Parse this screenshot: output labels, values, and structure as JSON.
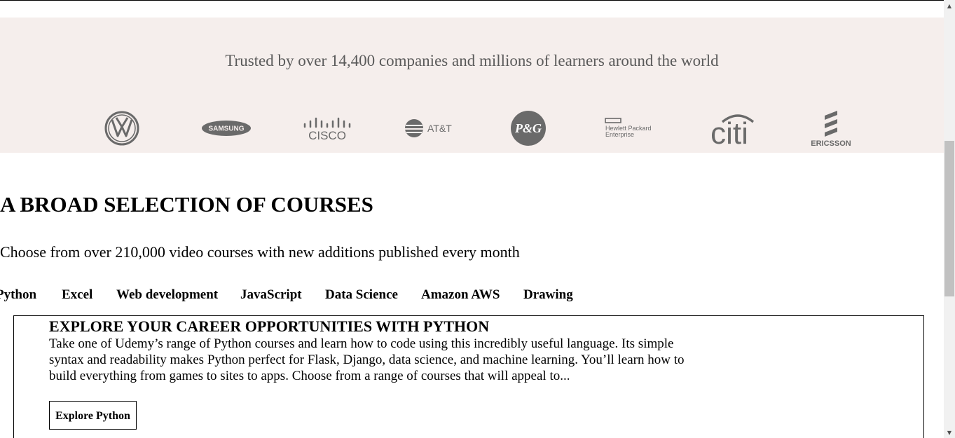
{
  "trusted": {
    "title": "Trusted by over 14,400 companies and millions of learners around the world",
    "logos": [
      {
        "name": "volkswagen",
        "icon": "volkswagen-logo"
      },
      {
        "name": "samsung",
        "icon": "samsung-logo",
        "text": "SAMSUNG"
      },
      {
        "name": "cisco",
        "icon": "cisco-logo",
        "text": "CISCO"
      },
      {
        "name": "att",
        "icon": "att-logo",
        "text": "AT&T"
      },
      {
        "name": "procter-gamble",
        "icon": "pg-logo",
        "text": "P&G"
      },
      {
        "name": "hewlett-packard-enterprise",
        "icon": "hpe-logo",
        "text_line1": "Hewlett Packard",
        "text_line2": "Enterprise"
      },
      {
        "name": "citi",
        "icon": "citi-logo",
        "text": "citi"
      },
      {
        "name": "ericsson",
        "icon": "ericsson-logo",
        "text": "ERICSSON"
      }
    ],
    "logo_color": "#6a6a6a",
    "background": "#f5eeec"
  },
  "courses": {
    "title": "A BROAD SELECTION OF COURSES",
    "subtitle": "Choose from over 210,000 video courses with new additions published every month",
    "tabs": [
      {
        "label": "Python"
      },
      {
        "label": "Excel"
      },
      {
        "label": "Web development"
      },
      {
        "label": "JavaScript"
      },
      {
        "label": "Data Science"
      },
      {
        "label": "Amazon AWS"
      },
      {
        "label": "Drawing"
      }
    ],
    "panel": {
      "title": "EXPLORE YOUR CAREER OPPORTUNITIES WITH PYTHON",
      "text": "Take one of Udemy’s range of Python courses and learn how to code using this incredibly useful language. Its simple syntax and readability makes Python perfect for Flask, Django, data science, and machine learning. You’ll learn how to build everything from games to sites to apps. Choose from a range of courses that will appeal to...",
      "button_label": "Explore Python"
    }
  },
  "scrollbar": {
    "up_icon": "triangle-up-icon",
    "down_icon": "triangle-down-icon"
  }
}
